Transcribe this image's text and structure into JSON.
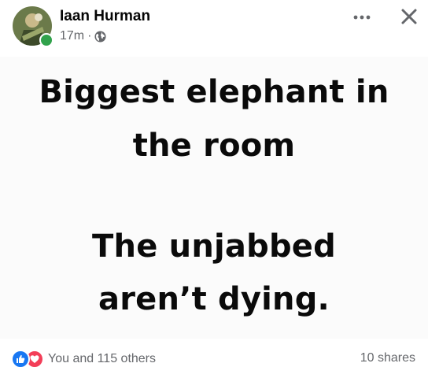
{
  "post": {
    "author": "Iaan Hurman",
    "time": "17m",
    "separator": "·",
    "privacy_icon": "globe-icon",
    "online": true
  },
  "header_actions": {
    "more_icon": "more-horizontal-icon",
    "close_icon": "close-icon"
  },
  "image_text": {
    "line1": "Biggest elephant in",
    "line2": "the room",
    "line3": "The unjabbed",
    "line4": "aren’t dying."
  },
  "footer": {
    "reaction_icons": [
      "like-icon",
      "love-icon"
    ],
    "reactions_text": "You and 115 others",
    "shares_text": "10 shares"
  },
  "colors": {
    "name": "#050505",
    "meta": "#65676b",
    "online": "#31a24c",
    "like": "#1877f2",
    "love": "#f33e58"
  }
}
